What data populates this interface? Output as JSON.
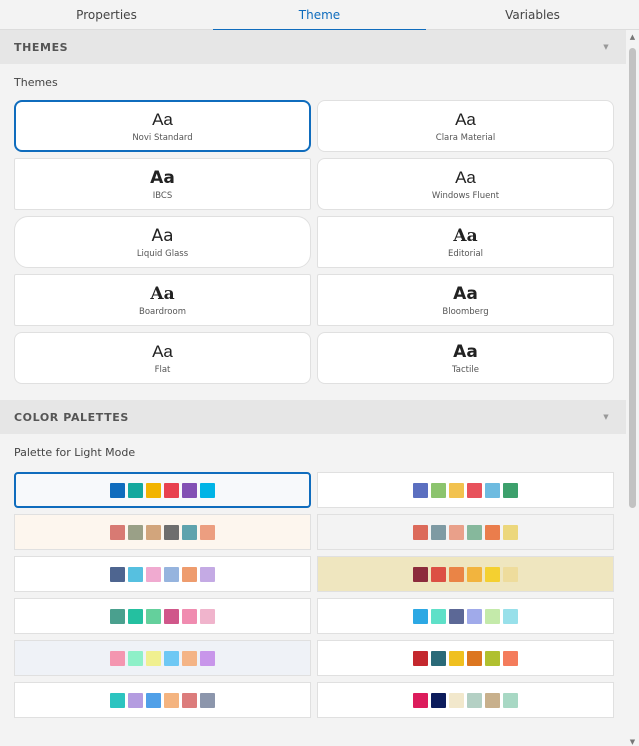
{
  "tabs": [
    {
      "label": "Properties"
    },
    {
      "label": "Theme"
    },
    {
      "label": "Variables"
    }
  ],
  "themes_section": {
    "title": "THEMES",
    "sub_label": "Themes",
    "items": [
      {
        "sample": "Aa",
        "name": "Novi Standard"
      },
      {
        "sample": "Aa",
        "name": "Clara Material"
      },
      {
        "sample": "Aa",
        "name": "IBCS"
      },
      {
        "sample": "Aa",
        "name": "Windows Fluent"
      },
      {
        "sample": "Aa",
        "name": "Liquid Glass"
      },
      {
        "sample": "Aa",
        "name": "Editorial"
      },
      {
        "sample": "Aa",
        "name": "Boardroom"
      },
      {
        "sample": "Aa",
        "name": "Bloomberg"
      },
      {
        "sample": "Aa",
        "name": "Flat"
      },
      {
        "sample": "Aa",
        "name": "Tactile"
      }
    ],
    "selected_index": 0
  },
  "palettes_section": {
    "title": "COLOR PALETTES",
    "sub_label": "Palette for Light Mode",
    "selected_index": 0,
    "items": [
      {
        "background": "#f7f9fb",
        "colors": [
          "#0f6cbd",
          "#13a89e",
          "#f2b400",
          "#e8414f",
          "#8250b4",
          "#00b4e6"
        ]
      },
      {
        "background": "#ffffff",
        "colors": [
          "#5b6fc0",
          "#8cc46e",
          "#f2c24f",
          "#e8525c",
          "#6ebbe0",
          "#3da06c"
        ]
      },
      {
        "background": "#fdf6ee",
        "colors": [
          "#d87a73",
          "#9aa087",
          "#d2a57c",
          "#6e6e6e",
          "#5fa3ad",
          "#ec9e80"
        ]
      },
      {
        "background": "#f3f3f3",
        "colors": [
          "#dc6a5a",
          "#7e9aa3",
          "#e9a08a",
          "#86b89c",
          "#ea7d4c",
          "#ecd77c"
        ]
      },
      {
        "background": "#ffffff",
        "colors": [
          "#4e6590",
          "#56c0e0",
          "#f0aad0",
          "#96b4de",
          "#ee9c6e",
          "#c4aae4"
        ]
      },
      {
        "background": "#efe6bf",
        "colors": [
          "#8c2c3c",
          "#dc5044",
          "#ea8446",
          "#f2b43e",
          "#f4d030",
          "#eedc9c"
        ]
      },
      {
        "background": "#ffffff",
        "colors": [
          "#4aa08e",
          "#24c0a0",
          "#64d09c",
          "#d0578a",
          "#f08cb0",
          "#f0b4cc"
        ]
      },
      {
        "background": "#ffffff",
        "colors": [
          "#2ca8e4",
          "#5ee0c8",
          "#5c6896",
          "#a0aaea",
          "#c4eaaa",
          "#98e0ea"
        ]
      },
      {
        "background": "#eff2f7",
        "colors": [
          "#f496b0",
          "#8ef0c8",
          "#f0f090",
          "#6ec8f4",
          "#f4b486",
          "#c896ea"
        ]
      },
      {
        "background": "#ffffff",
        "colors": [
          "#c4282e",
          "#2a6a78",
          "#f0c020",
          "#dc7620",
          "#b0c030",
          "#f47c5c"
        ]
      },
      {
        "background": "#ffffff",
        "colors": [
          "#2cc4c0",
          "#b49ce0",
          "#50a0e8",
          "#f4b480",
          "#dc7c7c",
          "#8c96ac"
        ]
      },
      {
        "background": "#ffffff",
        "colors": [
          "#dc1c5c",
          "#0c1c5c",
          "#f2e8cc",
          "#b4d0c4",
          "#c8b08c",
          "#a8d8c4"
        ]
      }
    ]
  },
  "icons": {
    "collapse": "chevron-down-icon",
    "scroll_up": "scroll-up-arrow-icon",
    "scroll_down": "scroll-down-arrow-icon"
  },
  "colors": {
    "accent": "#0f6cbd",
    "header_bg": "#e6e6e6",
    "panel_bg": "#f3f3f3"
  }
}
